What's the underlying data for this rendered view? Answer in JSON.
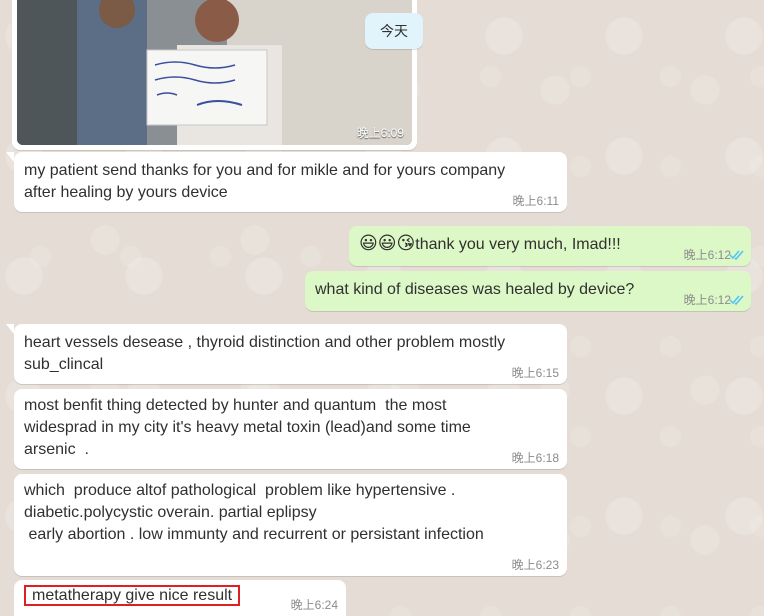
{
  "date_chip": "今天",
  "photo": {
    "time": "晚上6:09"
  },
  "messages": [
    {
      "dir": "in",
      "text": "my patient send thanks for you and for mikle and for yours company\nafter healing by yours device",
      "time": "晚上6:11"
    },
    {
      "dir": "out",
      "emoji": "😃😃😘",
      "text": "thank you very much, Imad!!!",
      "time": "晚上6:12"
    },
    {
      "dir": "out",
      "text": "what kind of diseases was healed by device?",
      "time": "晚上6:12"
    },
    {
      "dir": "in",
      "text": "heart vessels desease , thyroid distinction and other problem mostly\nsub_clincal",
      "time": "晚上6:15"
    },
    {
      "dir": "in",
      "text": "most benfit thing detected by hunter and quantum  the most\nwidesprad in my city it's heavy metal toxin (lead)and some time\narsenic  .",
      "time": "晚上6:18"
    },
    {
      "dir": "in",
      "text": "which  produce altof pathological  problem like hypertensive .\ndiabetic.polycystic overain. partial eplipsy\n early abortion . low immunty and recurrent or persistant infection",
      "time": "晚上6:23"
    },
    {
      "dir": "in",
      "text": "metatherapy give  nice result",
      "time": "晚上6:24"
    }
  ],
  "colors": {
    "incoming_bubble": "#ffffff",
    "outgoing_bubble": "#dcf8c6",
    "read_ticks": "#4fc3f7",
    "highlight_box": "#e02020"
  },
  "icons": [
    "double-check-icon"
  ]
}
